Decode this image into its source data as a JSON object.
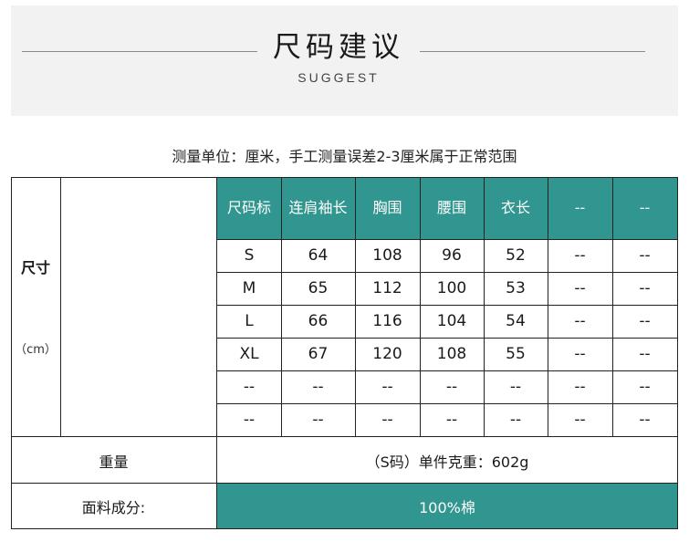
{
  "header": {
    "title": "尺码建议",
    "subtitle": "SUGGEST"
  },
  "note": "测量单位：厘米，手工测量误差2-3厘米属于正常范围",
  "colors": {
    "accent": "#31968f",
    "header_band": "#f2f2f2"
  },
  "table": {
    "side_label": "尺寸",
    "unit": "（cm）",
    "columns": [
      "尺码标",
      "连肩袖长",
      "胸围",
      "腰围",
      "衣长",
      "--",
      "--"
    ],
    "rows": [
      [
        "S",
        "64",
        "108",
        "96",
        "52",
        "--",
        "--"
      ],
      [
        "M",
        "65",
        "112",
        "100",
        "53",
        "--",
        "--"
      ],
      [
        "L",
        "66",
        "116",
        "104",
        "54",
        "--",
        "--"
      ],
      [
        "XL",
        "67",
        "120",
        "108",
        "55",
        "--",
        "--"
      ],
      [
        "--",
        "--",
        "--",
        "--",
        "--",
        "--",
        "--"
      ],
      [
        "--",
        "--",
        "--",
        "--",
        "--",
        "--",
        "--"
      ]
    ]
  },
  "weight": {
    "label": "重量",
    "value": "（S码）单件克重：602g"
  },
  "fabric": {
    "label": "面料成分:",
    "value": "100%棉"
  }
}
